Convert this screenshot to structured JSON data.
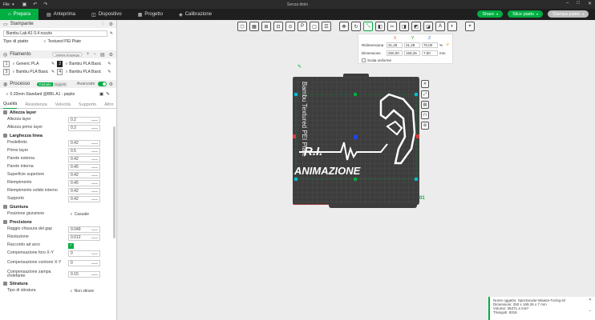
{
  "titlebar": {
    "menu": "File",
    "title": "Senza titolo"
  },
  "tabs": [
    {
      "label": "Prepara",
      "icon": "home-icon"
    },
    {
      "label": "Anteprima",
      "icon": "preview-icon"
    },
    {
      "label": "Dispositivo",
      "icon": "device-icon"
    },
    {
      "label": "Progetto",
      "icon": "project-icon"
    },
    {
      "label": "Calibrazione",
      "icon": "calibration-icon"
    }
  ],
  "actions": {
    "share": "Share",
    "slice": "Slice piatto",
    "print": "Stampa piatto"
  },
  "printer": {
    "header": "Stampante",
    "name": "Bambu Lab A1 0.4 nozzle",
    "plate_label": "Tipo di piatto",
    "plate_value": "Textured PEI Plate"
  },
  "filament": {
    "header": "Filamento",
    "chip": "Volumi di spurgo",
    "items": [
      {
        "num": "1",
        "name": "Generic PLA",
        "slot": "2",
        "preset": "Bambu PLA Basic"
      },
      {
        "num": "3",
        "name": "Bambu PLA Basic",
        "slot": "4",
        "preset": "Bambu PLA Basic"
      }
    ]
  },
  "process": {
    "header": "Processo",
    "global": "Globale",
    "objects": "Oggetti",
    "advanced": "Avanzate",
    "preset": "0.20mm Standard @BBL A1 - pepito"
  },
  "subtabs": [
    "Qualità",
    "Resistenza",
    "Velocità",
    "Supporto",
    "Altro"
  ],
  "groups": {
    "layer": {
      "title": "Altezza layer",
      "rows": [
        {
          "label": "Altezza layer",
          "value": "0.2"
        },
        {
          "label": "Altezza primo layer",
          "value": "0.2"
        }
      ]
    },
    "line": {
      "title": "Larghezza linea",
      "rows": [
        {
          "label": "Predefinito",
          "value": "0.42"
        },
        {
          "label": "Primo layer",
          "value": "0.5"
        },
        {
          "label": "Parete esterna",
          "value": "0.42"
        },
        {
          "label": "Parete interna",
          "value": "0.45"
        },
        {
          "label": "Superficie superiore",
          "value": "0.42"
        },
        {
          "label": "Riempimento",
          "value": "0.45"
        },
        {
          "label": "Riempimento solido interno",
          "value": "0.42"
        },
        {
          "label": "Supporto",
          "value": "0.42"
        }
      ]
    },
    "seam": {
      "title": "Giuntura",
      "label": "Posizione giunzione",
      "value": "Casuale"
    },
    "precision": {
      "title": "Precisione",
      "rows": [
        {
          "label": "Raggio chiusura del gap",
          "value": "0.049"
        },
        {
          "label": "Risoluzione",
          "value": "0.012"
        },
        {
          "label": "Raccordo ad arco",
          "value": "✓"
        },
        {
          "label": "Compensazione foro X-Y",
          "value": "0"
        },
        {
          "label": "Compensazione contorni X-Y",
          "value": "0"
        },
        {
          "label": "Compensazione zampa d'elefante",
          "value": "0.15"
        }
      ]
    },
    "ironing": {
      "title": "Stiratura",
      "label": "Tipo di stiratura",
      "value": "Non stirare"
    }
  },
  "scale_panel": {
    "x": "X",
    "y": "Y",
    "z": "Z",
    "scale_label": "Ridimensiona",
    "scale": [
      "31,28",
      "31,28",
      "70,00"
    ],
    "pct": "%",
    "dim_label": "Dimensione",
    "dims": [
      "250,00",
      "169,26",
      "7,00"
    ],
    "mm": "mm",
    "uniform": "Scala uniforme"
  },
  "plate": {
    "number": "01",
    "bed_label": "Bambu Textured PEI Plate",
    "text1": "R.I.",
    "text2": "ANIMAZIONE"
  },
  "info": {
    "name": "Nome oggetto: Spectacular-Waasa-Turing.stl",
    "dims": "Dimensioni: 250 x 169.26 x 7 mm",
    "volume": "Volume: 35371.4 mm³",
    "triangles": "Triangoli: 8318"
  }
}
